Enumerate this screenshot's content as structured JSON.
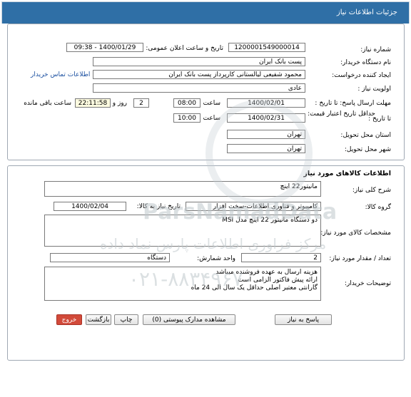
{
  "header": {
    "title": "جزئیات اطلاعات نیاز"
  },
  "info": {
    "need_number_label": "شماره نیاز:",
    "need_number": "1200001549000014",
    "announce_label": "تاریخ و ساعت اعلان عمومی:",
    "announce_value": "1400/01/29 - 09:38",
    "buyer_label": "نام دستگاه خریدار:",
    "buyer": "پست بانک ایران",
    "creator_label": "ایجاد کننده درخواست:",
    "creator": "محمود شفیعی لیالستانی کارپرداز پست بانک ایران",
    "contact_link": "اطلاعات تماس خریدار",
    "priority_label": "اولویت نیاز :",
    "priority": "عادی",
    "deadline_label": "مهلت ارسال پاسخ: تا تاریخ :",
    "deadline_date": "1400/02/01",
    "time_label": "ساعت",
    "deadline_time": "08:00",
    "days": "2",
    "days_label": "روز و",
    "remaining": "22:11:58",
    "remaining_label": "ساعت باقی مانده",
    "validity_label": "حداقل تاریخ اعتبار قیمت:",
    "validity_to": "تا تاریخ :",
    "validity_date": "1400/02/31",
    "validity_time_label": "ساعت",
    "validity_time": "10:00",
    "province_label": "استان محل تحویل:",
    "province": "تهران",
    "city_label": "شهر محل تحویل:",
    "city": "تهران"
  },
  "goods": {
    "title": "اطلاعات کالاهای مورد نیاز",
    "summary_label": "شرح کلی نیاز:",
    "summary": "مانیتور22 اینچ",
    "group_label": "گروه کالا:",
    "group": "کامپیوتر و فناوری اطلاعات-سخت افزار",
    "need_date_label": "تاریخ نیاز به کالا:",
    "need_date": "1400/02/04",
    "specs_label": "مشخصات کالای مورد نیاز:",
    "specs": "دو دستگاه مانیتور 22 اینچ مدل MSI",
    "qty_label": "تعداد / مقدار مورد نیاز:",
    "qty": "2",
    "unit_label": "واحد شمارش:",
    "unit": "دستگاه",
    "notes_label": "توضیحات خریدار:",
    "notes": [
      "هزینه ارسال به عهده فروشنده میباشد",
      "ارائه پیش فاکتور الزامی است",
      "گارانتی معتبر اصلی حداقل یک سال الی 24 ماه"
    ]
  },
  "buttons": {
    "reply": "پاسخ به نیاز",
    "attachments": "مشاهده مدارک پیوستی (0)",
    "print": "چاپ",
    "back": "بازگشت",
    "exit": "خروج"
  },
  "watermark": {
    "line1": "ParsNamadData",
    "line2": "مرکز فراوری اطلاعات پارس نماد داده",
    "phone": "۰۲۱-۸۸۳۴۹۶۷۰"
  }
}
